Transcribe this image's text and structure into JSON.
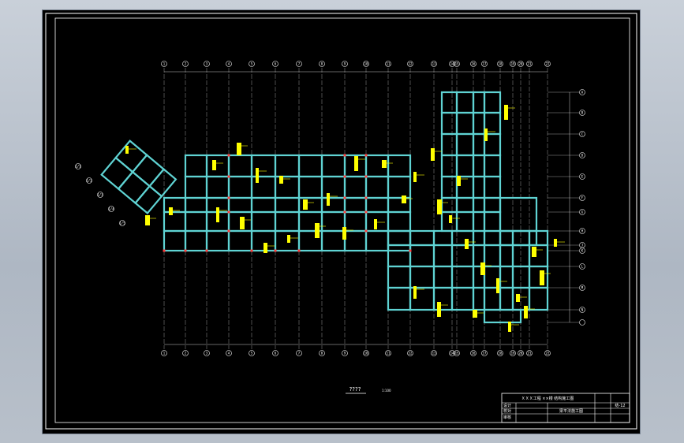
{
  "drawing": {
    "main_title": "????",
    "scale_note": "1:100",
    "colors": {
      "background": "#000000",
      "frame": "#ffffff",
      "gridline": "#ffffff",
      "beam": "#5fd3d3",
      "annotation": "#ffff00",
      "column": "#ff3b3b"
    }
  },
  "axes": {
    "top_labels": [
      "1",
      "2",
      "3",
      "4",
      "5",
      "6",
      "7",
      "8",
      "9",
      "10",
      "11",
      "12",
      "13",
      "14",
      "15",
      "16",
      "17",
      "18",
      "19",
      "20",
      "21",
      "22"
    ],
    "right_labels": [
      "A",
      "B",
      "C",
      "D",
      "E",
      "F",
      "G",
      "H",
      "J",
      "K",
      "L",
      "M",
      "N"
    ],
    "left_labels": [
      "1/1",
      "1/2",
      "1/3",
      "1/4",
      "1/5"
    ]
  },
  "title_block": {
    "project": "ＸＸＸ工程 ××楼 结构施工图",
    "drawing_name": "梁平法施工图",
    "drawing_no": "结-12",
    "rows": [
      "设计",
      "校对",
      "审核"
    ]
  }
}
